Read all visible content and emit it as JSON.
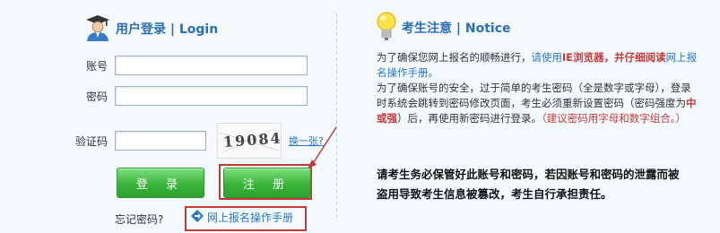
{
  "login": {
    "title": "用户登录",
    "title_en": "Login",
    "separator": " | ",
    "username_label": "账号",
    "password_label": "密码",
    "captcha_label": "验证码",
    "captcha_text": "19084",
    "refresh_label": "换一张?",
    "login_button": "登 录",
    "register_button": "注 册",
    "forgot_password": "忘记密码?",
    "manual_link": "网上报名操作手册"
  },
  "notice": {
    "title": "考生注意",
    "title_en": "Notice",
    "separator": " | ",
    "p1_a": "为了确保您网上报名的顺畅进行，",
    "p1_b": "请使用",
    "p1_c": "IE浏览器，并仔细阅读",
    "p1_d": "网上报名操作手册。",
    "p2": "为了确保账号的安全，过于简单的考生密码（全是数字或字母），登录时系统会跳转到密码修改页面，考生必须重新设置密码（密码强度为",
    "p2_strength": "中或强",
    "p2_c": "）后，再使用新密码进行登录。",
    "p2_d": "（建议密码用字母和数字组合。）",
    "warning": "请考生务必保管好此账号和密码，若因账号和密码的泄露而被 盗用导致考生信息被篡改，考生自行承担责任。"
  },
  "colors": {
    "accent_blue": "#2b6fb3",
    "button_green": "#3ab53a",
    "highlight_red": "#c23a3a"
  },
  "icons": {
    "login_header": "graduate-user-icon",
    "notice_header": "lightbulb-icon",
    "manual": "diamond-arrow-icon"
  }
}
